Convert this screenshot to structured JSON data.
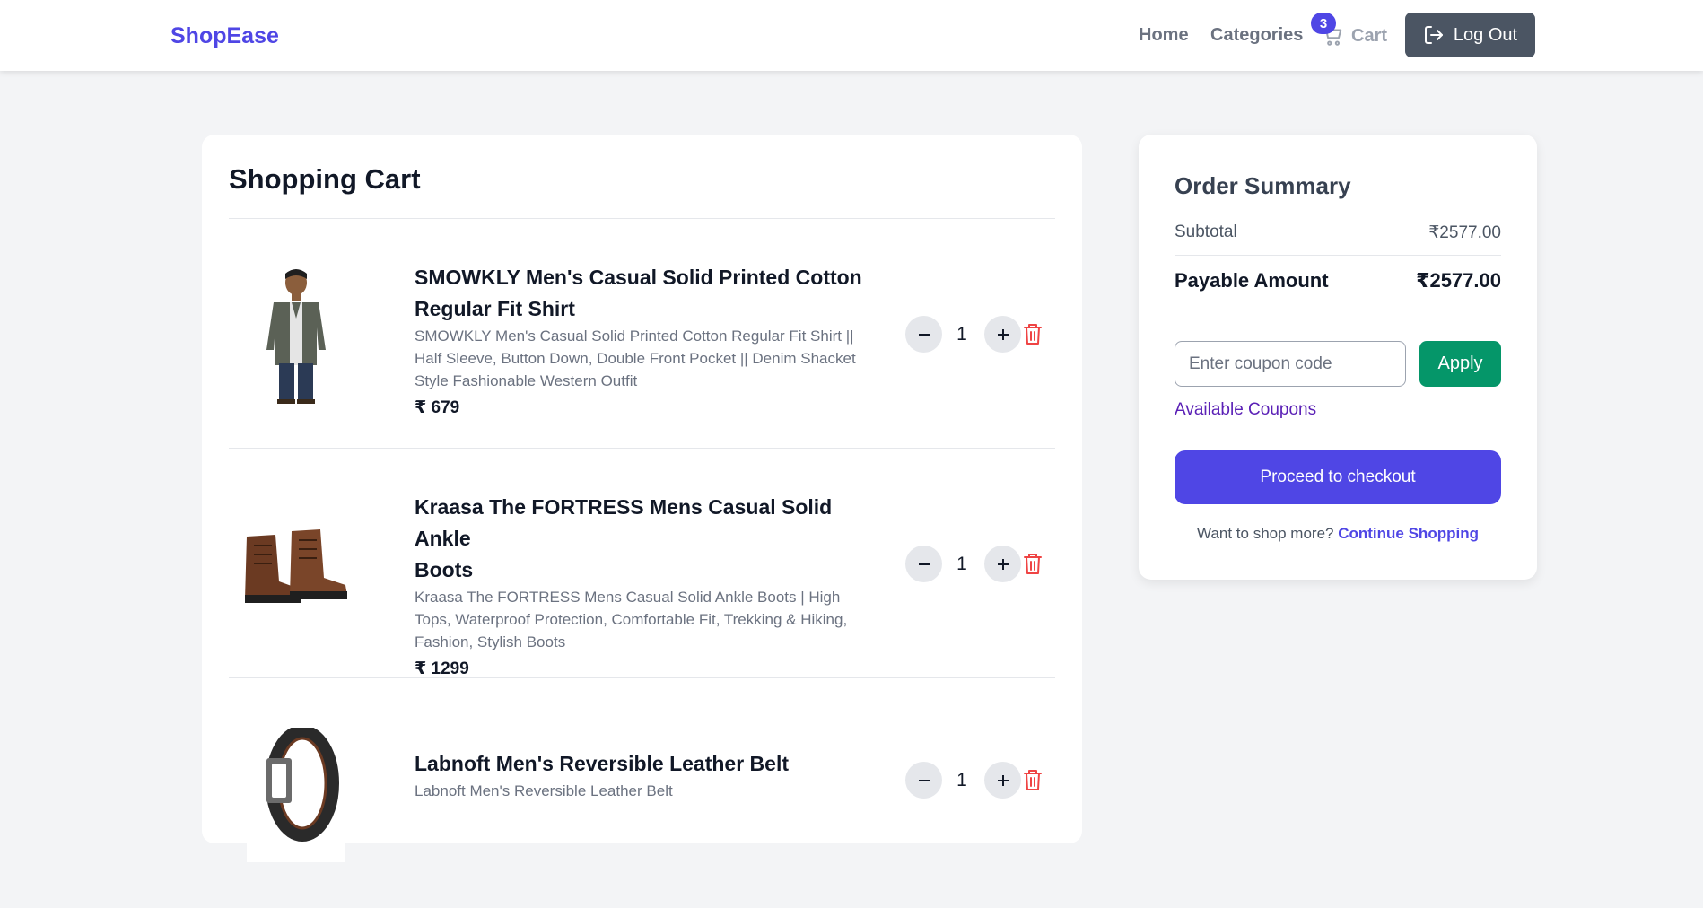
{
  "brand": "ShopEase",
  "nav": {
    "home": "Home",
    "categories": "Categories",
    "cart": "Cart",
    "cart_count": "3",
    "logout": "Log Out"
  },
  "cart": {
    "title": "Shopping Cart",
    "items": [
      {
        "name_line1": "SMOWKLY Men's Casual Solid Printed Cotton",
        "name_line2": "Regular Fit Shirt",
        "desc_line1": "SMOWKLY Men's Casual Solid Printed Cotton Regular Fit Shirt ||",
        "desc_line2": "Half Sleeve, Button Down, Double Front Pocket || Denim Shacket",
        "desc_line3": "Style Fashionable Western Outfit",
        "price": "₹ 679",
        "qty": "1",
        "image": "shirt-image"
      },
      {
        "name_line1": "Kraasa The FORTRESS Mens Casual Solid Ankle",
        "name_line2": "Boots",
        "desc_line1": "Kraasa The FORTRESS Mens Casual Solid Ankle Boots | High",
        "desc_line2": "Tops, Waterproof Protection, Comfortable Fit, Trekking & Hiking,",
        "desc_line3": "Fashion, Stylish Boots",
        "price": "₹ 1299",
        "qty": "1",
        "image": "boots-image"
      },
      {
        "name_line1": "Labnoft Men's Reversible Leather Belt",
        "desc_line1": "Labnoft Men's Reversible Leather Belt",
        "qty": "1",
        "image": "belt-image"
      }
    ]
  },
  "summary": {
    "title": "Order Summary",
    "subtotal_label": "Subtotal",
    "subtotal_value": "₹2577.00",
    "payable_label": "Payable Amount",
    "payable_value": "₹2577.00",
    "coupon_placeholder": "Enter coupon code",
    "apply_label": "Apply",
    "available_coupons": "Available Coupons",
    "checkout_label": "Proceed to checkout",
    "shop_more_text": "Want to shop more?",
    "continue_shopping": "Continue Shopping"
  },
  "colors": {
    "brand": "#4f46e5",
    "apply": "#059669",
    "trash": "#ef4444",
    "logout_bg": "#4b5563"
  },
  "icons": [
    "cart-icon",
    "logout-icon",
    "minus-icon",
    "plus-icon",
    "trash-icon"
  ]
}
